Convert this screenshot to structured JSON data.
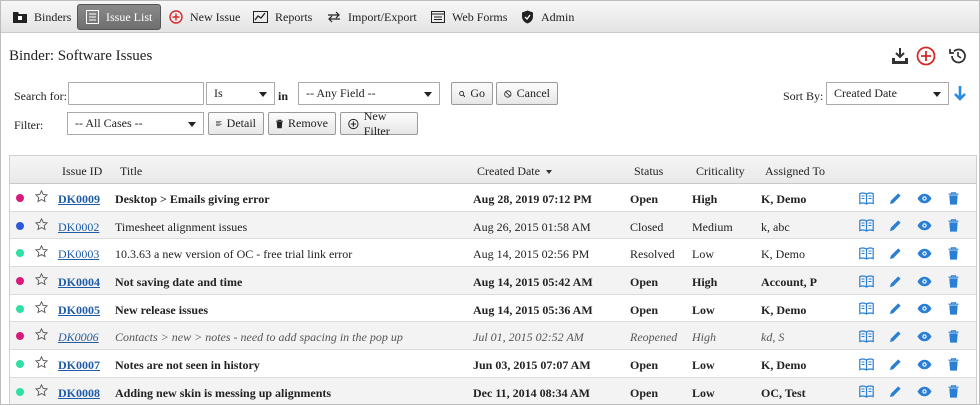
{
  "nav": [
    {
      "label": "Binders",
      "icon": "binder-icon"
    },
    {
      "label": "Issue List",
      "icon": "list-icon"
    },
    {
      "label": "New Issue",
      "icon": "plus-circle-icon"
    },
    {
      "label": "Reports",
      "icon": "chart-icon"
    },
    {
      "label": "Import/Export",
      "icon": "import-export-icon"
    },
    {
      "label": "Web Forms",
      "icon": "form-icon"
    },
    {
      "label": "Admin",
      "icon": "shield-icon"
    }
  ],
  "header": {
    "title": "Binder: Software Issues"
  },
  "search": {
    "label": "Search for:",
    "value": "",
    "operator": "Is",
    "in_label": "in",
    "field": "-- Any Field --",
    "go_label": "Go",
    "cancel_label": "Cancel"
  },
  "sort": {
    "label": "Sort By:",
    "value": "Created Date"
  },
  "filter": {
    "label": "Filter:",
    "value": "-- All Cases --",
    "detail_label": "Detail",
    "remove_label": "Remove",
    "new_filter_label": "New Filter"
  },
  "columns": {
    "id": "Issue ID",
    "title": "Title",
    "created": "Created Date",
    "status": "Status",
    "criticality": "Criticality",
    "assigned": "Assigned To"
  },
  "colors": {
    "pink": "#d81b7a",
    "blue": "#2c59d9",
    "teal": "#2ee0a6",
    "accent_red": "#d62828",
    "action_blue": "#2a7fd4"
  },
  "rows": [
    {
      "dot": "pink",
      "style": "b",
      "id": "DK0009",
      "title": "Desktop > Emails giving error",
      "created": "Aug 28, 2019 07:12 PM",
      "status": "Open",
      "criticality": "High",
      "assigned": "K, Demo"
    },
    {
      "dot": "blue",
      "style": "n",
      "id": "DK0002",
      "title": "Timesheet alignment issues",
      "created": "Aug 26, 2015 01:58 AM",
      "status": "Closed",
      "criticality": "Medium",
      "assigned": "k, abc"
    },
    {
      "dot": "teal",
      "style": "n",
      "id": "DK0003",
      "title": "10.3.63 a new version of OC - free trial link error",
      "created": "Aug 14, 2015 02:56 PM",
      "status": "Resolved",
      "criticality": "Low",
      "assigned": "K, Demo"
    },
    {
      "dot": "pink",
      "style": "b",
      "id": "DK0004",
      "title": "Not saving date and time",
      "created": "Aug 14, 2015 05:42 AM",
      "status": "Open",
      "criticality": "High",
      "assigned": "Account, P"
    },
    {
      "dot": "teal",
      "style": "b",
      "id": "DK0005",
      "title": "New release issues",
      "created": "Aug 14, 2015 05:36 AM",
      "status": "Open",
      "criticality": "Low",
      "assigned": "K, Demo"
    },
    {
      "dot": "pink",
      "style": "i",
      "id": "DK0006",
      "title": "Contacts > new > notes - need to add spacing in the pop up",
      "created": "Jul 01, 2015 02:52 AM",
      "status": "Reopened",
      "criticality": "High",
      "assigned": "kd, S"
    },
    {
      "dot": "teal",
      "style": "b",
      "id": "DK0007",
      "title": "Notes are not seen in history",
      "created": "Jun 03, 2015 07:07 AM",
      "status": "Open",
      "criticality": "Low",
      "assigned": "K, Demo"
    },
    {
      "dot": "teal",
      "style": "b",
      "id": "DK0008",
      "title": "Adding new skin is messing up alignments",
      "created": "Dec 11, 2014 08:34 AM",
      "status": "Open",
      "criticality": "Low",
      "assigned": "OC, Test"
    }
  ]
}
